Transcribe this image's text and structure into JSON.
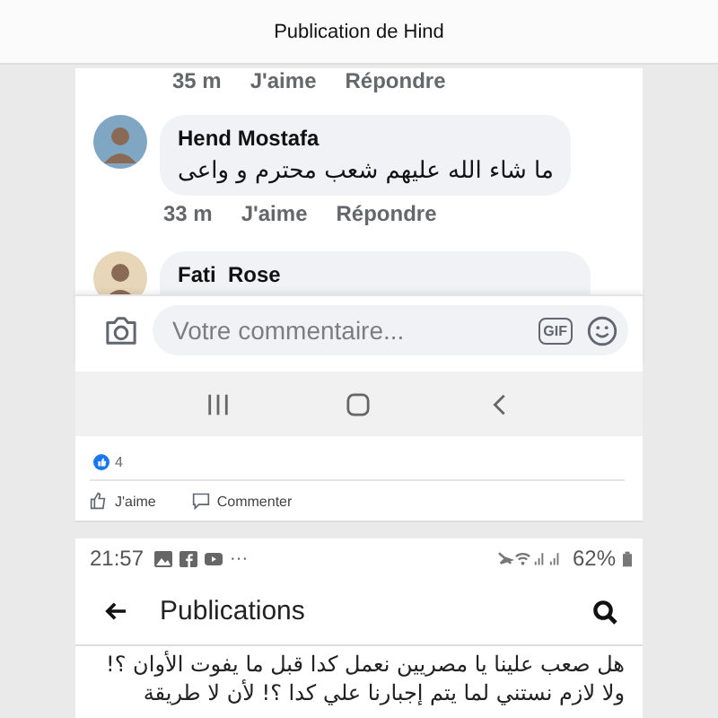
{
  "header": {
    "title": "Publication de Hind"
  },
  "first_screenshot": {
    "previous_meta": {
      "time": "35 m",
      "like": "J'aime",
      "reply": "Répondre"
    },
    "comments": [
      {
        "author": "Hend Mostafa",
        "text": "ما شاء الله  عليهم شعب محترم و واعى",
        "time": "33 m",
        "like": "J'aime",
        "reply": "Répondre"
      },
      {
        "author": "Fati  Rose"
      }
    ],
    "comment_input": {
      "placeholder": "Votre commentaire...",
      "gif": "GIF"
    }
  },
  "reactions": {
    "count": "4"
  },
  "actions": [
    {
      "kind": "like",
      "label": "J'aime"
    },
    {
      "kind": "comment",
      "label": "Commenter"
    }
  ],
  "second_screenshot": {
    "status_bar": {
      "time": "21:57",
      "more": "···",
      "battery": "62%"
    },
    "title": "Publications",
    "post_lines": [
      "هل صعب علينا يا مصريين نعمل كدا قبل ما يفوت الأوان ؟!",
      "ولا لازم نستني لما يتم إجبارنا علي كدا ؟!  لأن لا طريقة"
    ]
  }
}
